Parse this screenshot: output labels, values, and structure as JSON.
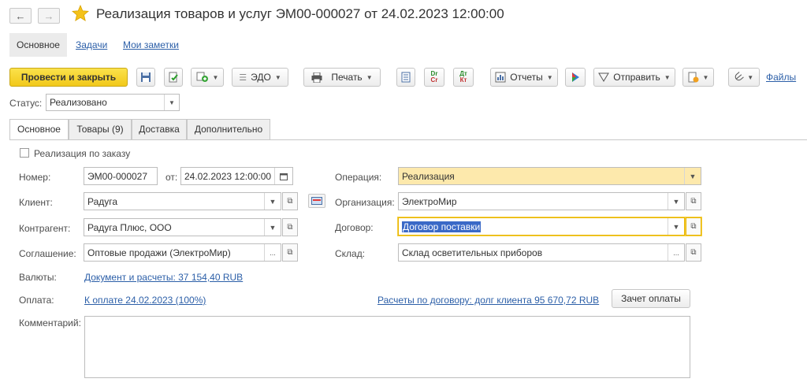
{
  "window": {
    "back_icon": "arrow-left",
    "forward_icon": "arrow-right",
    "favorite_icon": "star",
    "title": "Реализация товаров и услуг ЭМ00-000027 от 24.02.2023 12:00:00"
  },
  "panel": {
    "tabs": [
      "Основное",
      "Задачи",
      "Мои заметки"
    ]
  },
  "toolbar": {
    "post_close": "Провести и закрыть",
    "edo": "ЭДО",
    "print": "Печать",
    "dr": "Dr",
    "cr": "Cr",
    "dt": "Дт",
    "kt": "Кт",
    "reports": "Отчеты",
    "send": "Отправить",
    "files": "Файлы"
  },
  "status": {
    "label": "Статус:",
    "value": "Реализовано"
  },
  "tabs": [
    "Основное",
    "Товары (9)",
    "Доставка",
    "Дополнительно"
  ],
  "form": {
    "by_order": "Реализация по заказу",
    "number_label": "Номер:",
    "number_value": "ЭМ00-000027",
    "date_from_label": "от:",
    "date_value": "24.02.2023 12:00:00",
    "client_label": "Клиент:",
    "client_value": "Радуга",
    "counterparty_label": "Контрагент:",
    "counterparty_value": "Радуга Плюс, ООО",
    "agreement_label": "Соглашение:",
    "agreement_value": "Оптовые продажи (ЭлектроМир)",
    "operation_label": "Операция:",
    "operation_value": "Реализация",
    "organization_label": "Организация:",
    "organization_value": "ЭлектроМир",
    "contract_label": "Договор:",
    "contract_value": "Договор поставки",
    "warehouse_label": "Склад:",
    "warehouse_value": "Склад осветительных приборов",
    "currency_label": "Валюты:",
    "currency_link": "Документ и расчеты: 37 154,40 RUB",
    "payment_label": "Оплата:",
    "payment_link": "К оплате 24.02.2023 (100%)",
    "settlements_link": "Расчеты по договору: долг клиента 95 670,72 RUB",
    "offset_button": "Зачет оплаты",
    "comment_label": "Комментарий:",
    "comment_value": ""
  },
  "colors": {
    "primary_button": "#f1c81a",
    "link": "#2c5fa8",
    "highlight_field": "#fde9ac",
    "selection": "#3a69c7"
  }
}
